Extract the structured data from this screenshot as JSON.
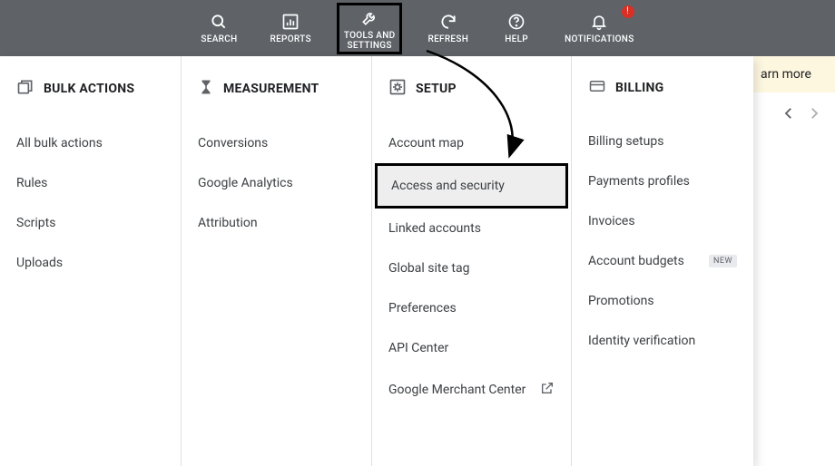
{
  "topbar": {
    "items": [
      {
        "label": "SEARCH"
      },
      {
        "label": "REPORTS"
      },
      {
        "label": "TOOLS AND\nSETTINGS"
      },
      {
        "label": "REFRESH"
      },
      {
        "label": "HELP"
      },
      {
        "label": "NOTIFICATIONS"
      }
    ],
    "notif_badge": "!"
  },
  "columns": {
    "bulk": {
      "header": "BULK ACTIONS",
      "items": [
        "All bulk actions",
        "Rules",
        "Scripts",
        "Uploads"
      ]
    },
    "measurement": {
      "header": "MEASUREMENT",
      "items": [
        "Conversions",
        "Google Analytics",
        "Attribution"
      ]
    },
    "setup": {
      "header": "SETUP",
      "items": [
        "Account map",
        "Access and security",
        "Linked accounts",
        "Global site tag",
        "Preferences",
        "API Center",
        "Google Merchant Center"
      ]
    },
    "billing": {
      "header": "BILLING",
      "items": [
        "Billing setups",
        "Payments profiles",
        "Invoices",
        "Account budgets",
        "Promotions",
        "Identity verification"
      ],
      "new_badge": "NEW"
    }
  },
  "right": {
    "learn_more": "arn more"
  }
}
